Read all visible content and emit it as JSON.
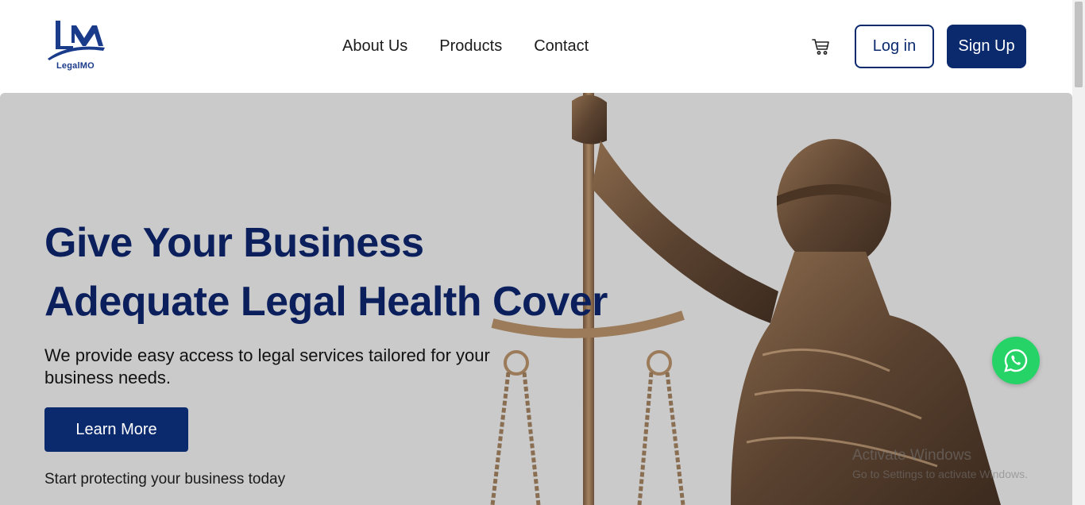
{
  "brand": {
    "logo_text": "LegalMO",
    "logo_icon": "legalmo-logo"
  },
  "nav": {
    "items": [
      {
        "label": "About Us"
      },
      {
        "label": "Products"
      },
      {
        "label": "Contact"
      }
    ]
  },
  "header": {
    "cart_icon": "cart-icon",
    "login_label": "Log in",
    "signup_label": "Sign Up"
  },
  "hero": {
    "title_line1": "Give Your Business",
    "title_line2": "Adequate Legal Health Cover",
    "subtitle": "We provide easy access to legal services tailored for your business needs.",
    "cta_label": "Learn More",
    "note": "Start protecting your business today",
    "image": "lady-justice-statue"
  },
  "overlay": {
    "watermark_title": "Activate Windows",
    "watermark_subtitle": "Go to Settings to activate Windows.",
    "chat_icon": "whatsapp-icon"
  },
  "colors": {
    "brand_navy": "#0b2a6e",
    "title_navy": "#0a1f5c",
    "hero_bg": "#cacaca",
    "whatsapp_green": "#25d366"
  }
}
